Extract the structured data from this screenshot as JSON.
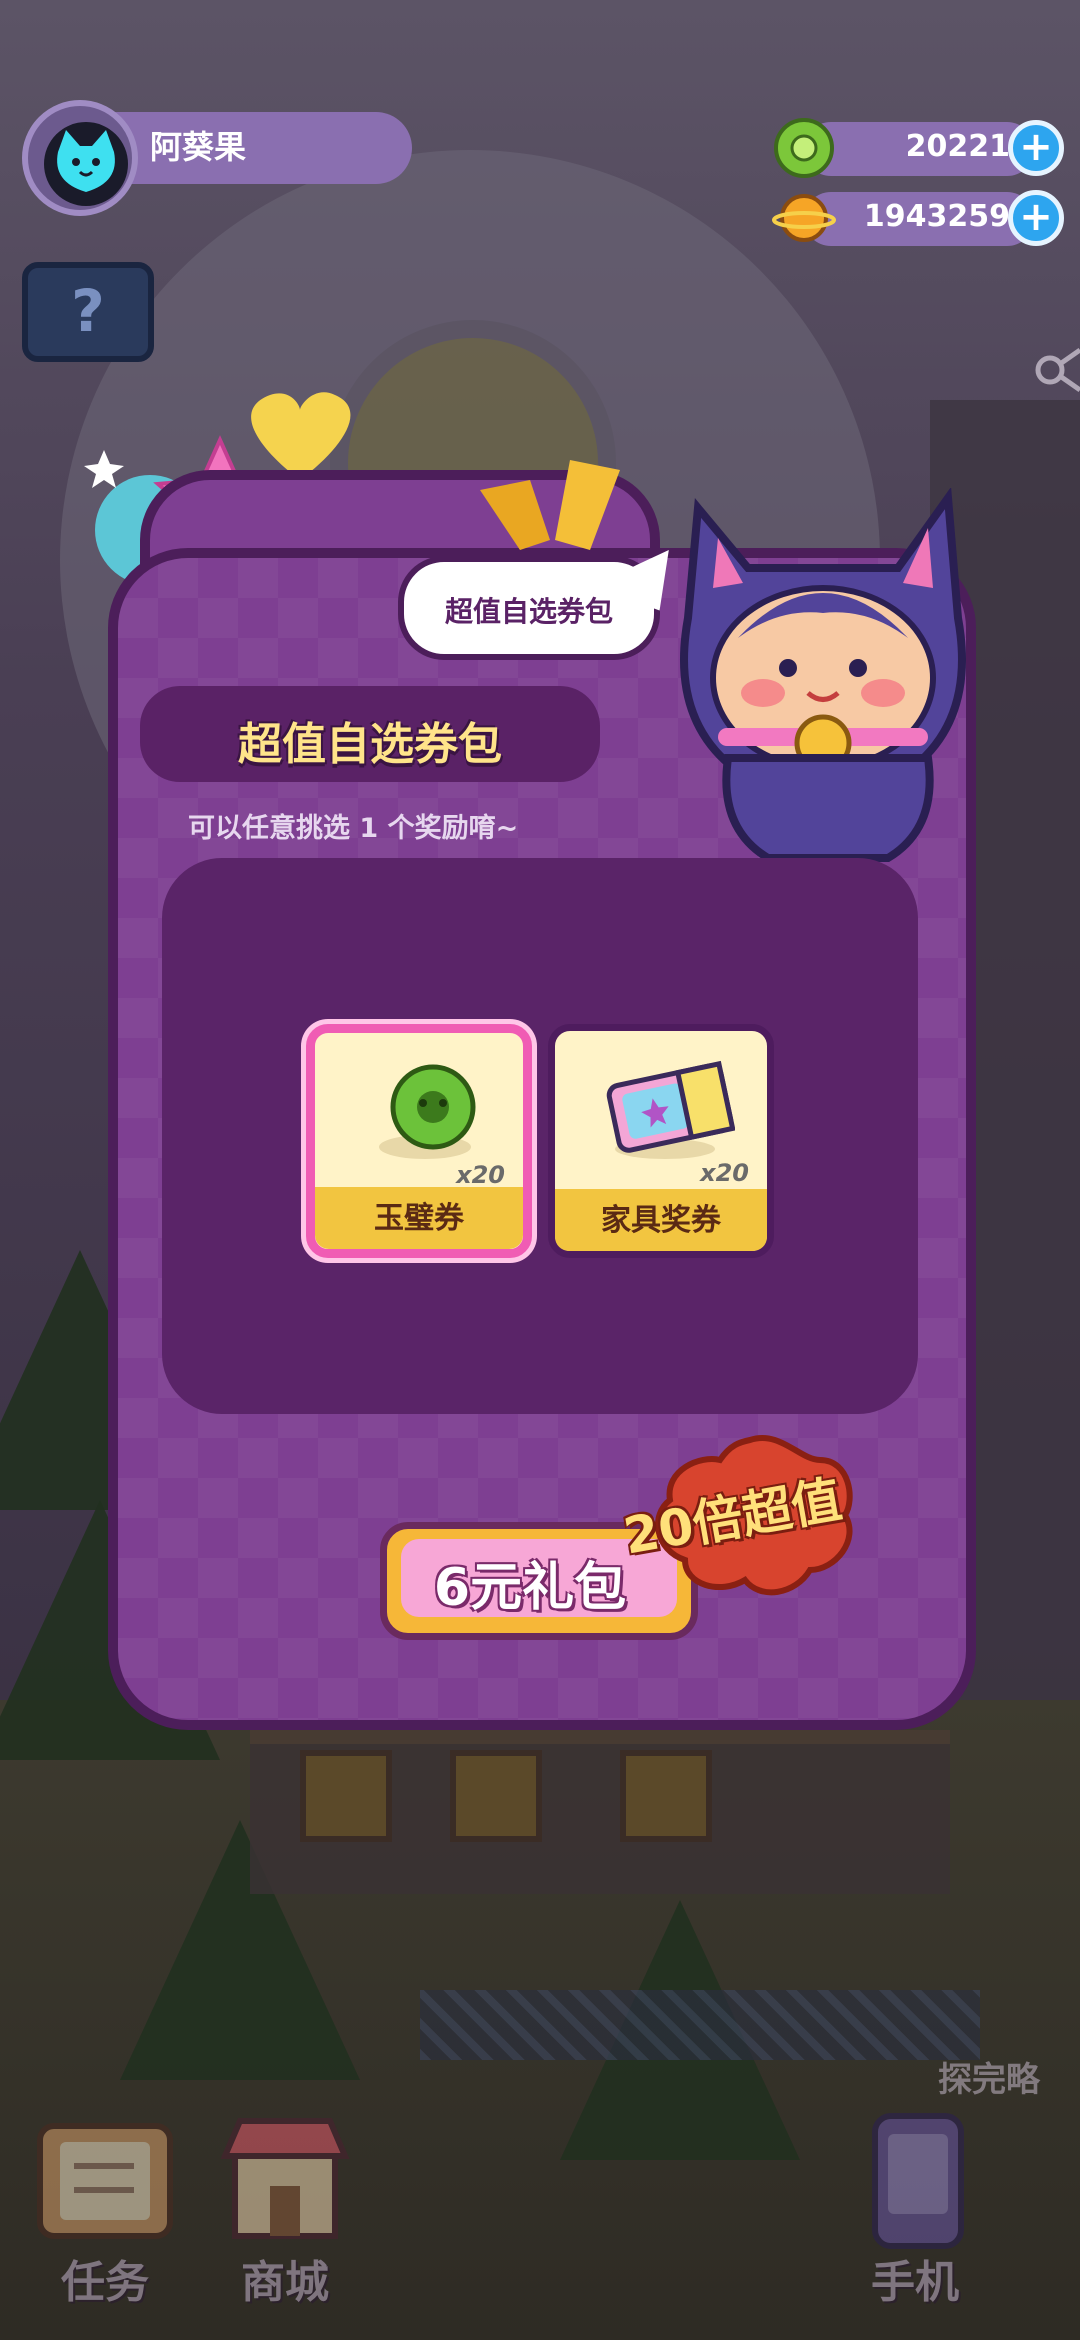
{
  "player": {
    "name": "阿葵果"
  },
  "currencies": [
    {
      "name": "jade-coin",
      "value": "20221",
      "icon": "green-gear-coin-icon"
    },
    {
      "name": "gold-coin",
      "value": "1943259",
      "icon": "orange-planet-coin-icon"
    }
  ],
  "popup": {
    "bubble_text": "超值自选券包",
    "title": "超值自选券包",
    "subtitle": "可以任意挑选 1 个奖励唷~",
    "rewards": [
      {
        "label": "玉璧券",
        "quantity": "x20",
        "selected": true,
        "icon": "jade-coupon-icon"
      },
      {
        "label": "家具奖券",
        "quantity": "x20",
        "selected": false,
        "icon": "furniture-ticket-icon"
      }
    ],
    "buy_button": "6元礼包",
    "value_badge": "20倍超值"
  },
  "nav": {
    "tasks": "任务",
    "shop": "商城",
    "phone": "手机"
  },
  "scene": {
    "map_hint": "探完略"
  },
  "colors": {
    "panel": "#7e3f92",
    "panel_border": "#4c1e5a",
    "title_text": "#ffe48a",
    "selected_border": "#f05cb4",
    "plus_button": "#2da5ef"
  }
}
